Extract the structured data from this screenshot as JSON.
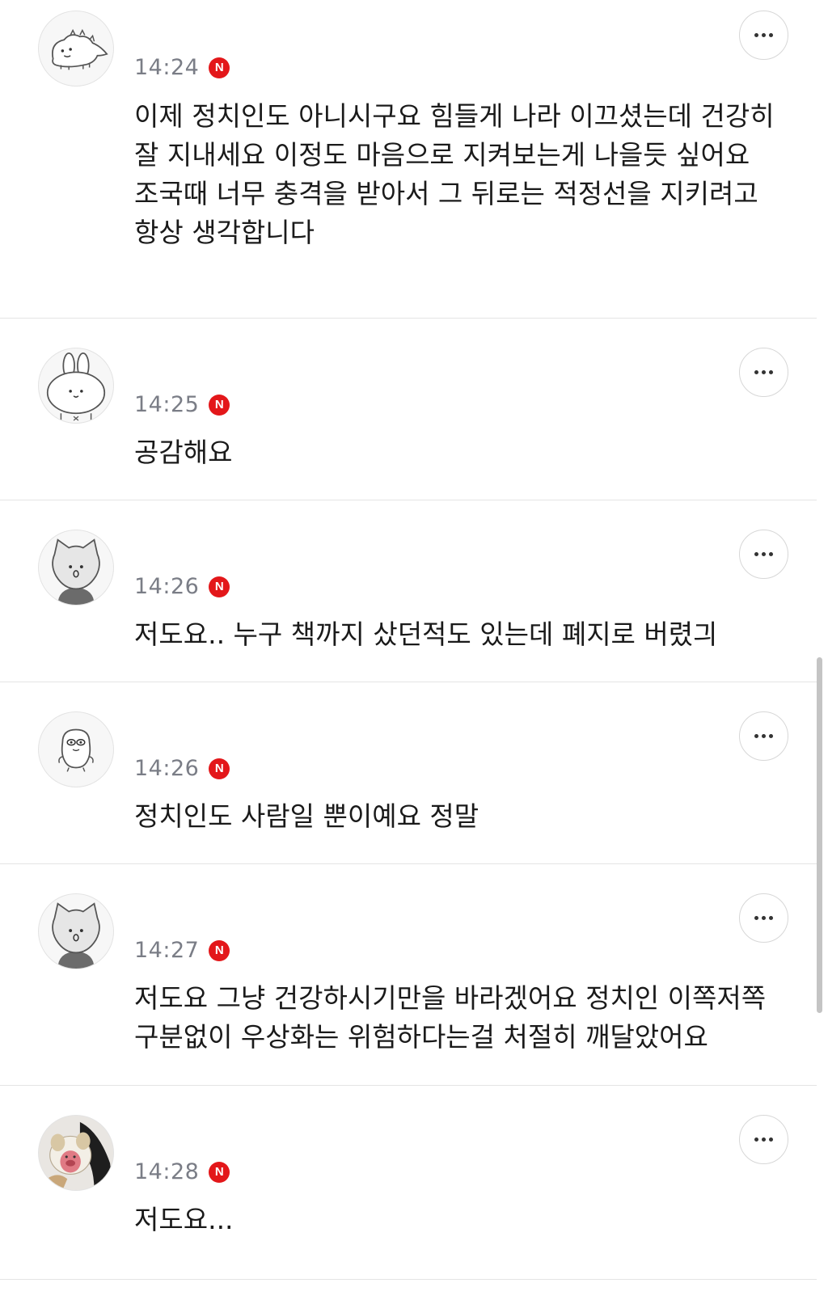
{
  "comments": [
    {
      "time": "14:24",
      "badge": "N",
      "text": "이제 정치인도 아니시구요 힘들게 나라 이끄셨는데 건강히 잘 지내세요 이정도 마음으로 지켜보는게 나을듯 싶어요  조국때 너무 충격을 받아서 그 뒤로는 적정선을 지키려고 항상 생각합니다",
      "avatar": "dinosaur-avatar-icon"
    },
    {
      "time": "14:25",
      "badge": "N",
      "text": "공감해요",
      "avatar": "bunny-avatar-icon"
    },
    {
      "time": "14:26",
      "badge": "N",
      "text": "저도요.. 누구 책까지 샀던적도 있는데 폐지로 버렸긔",
      "avatar": "cat-avatar-icon"
    },
    {
      "time": "14:26",
      "badge": "N",
      "text": "정치인도 사람일 뿐이예요 정말",
      "avatar": "blob-avatar-icon"
    },
    {
      "time": "14:27",
      "badge": "N",
      "text": "저도요 그냥 건강하시기만을 바라겠어요 정치인 이쪽저쪽 구분없이 우상화는 위험하다는걸 처절히 깨달았어요",
      "avatar": "cat-avatar-icon"
    },
    {
      "time": "14:28",
      "badge": "N",
      "text": "저도요...",
      "avatar": "plush-photo-avatar"
    }
  ],
  "colors": {
    "badge": "#e3171a",
    "timestamp": "#7a7d86",
    "divider": "#e4e4e4"
  }
}
